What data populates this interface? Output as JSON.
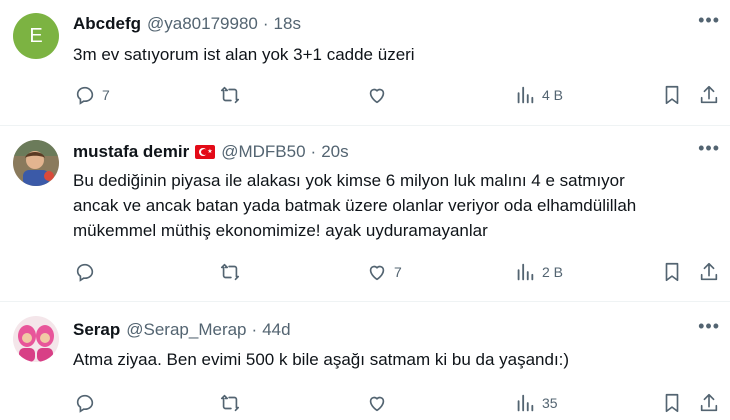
{
  "tweets": [
    {
      "avatar_letter": "E",
      "name": "Abcdefg",
      "handle": "@ya80179980",
      "time": "18s",
      "text": [
        "3m ev satıyorum ist alan yok 3+1 cadde üzeri"
      ],
      "replies": "7",
      "retweets": "",
      "likes": "",
      "views": "4 B"
    },
    {
      "name": "mustafa demir",
      "handle": "@MDFB50",
      "time": "20s",
      "text": [
        "Bu dediğinin piyasa ile alakası yok kimse 6 milyon luk malını 4 e satmıyor",
        "ancak ve ancak batan yada batmak üzere olanlar veriyor oda elhamdülillah",
        "mükemmel müthiş ekonomimize! ayak uyduramayanlar"
      ],
      "replies": "",
      "retweets": "",
      "likes": "7",
      "views": "2 B"
    },
    {
      "name": "Serap",
      "handle": "@Serap_Merap",
      "time": "44d",
      "text": [
        "Atma ziyaa. Ben evimi 500 k bile aşağı satmam ki bu da yaşandı:)"
      ],
      "replies": "",
      "retweets": "",
      "likes": "",
      "views": "35"
    }
  ],
  "separator": "·",
  "colors": {
    "avatar_e": "#7cb342",
    "muted": "#536471",
    "text": "#0f1419"
  }
}
